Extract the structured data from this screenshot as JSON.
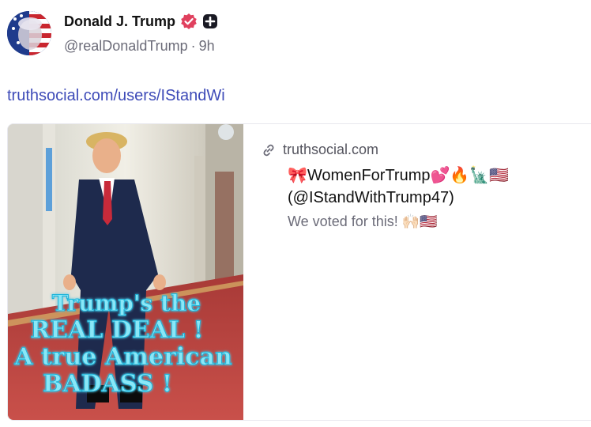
{
  "author": {
    "display_name": "Donald J. Trump",
    "handle": "@realDonaldTrump",
    "separator": "·",
    "time_ago": "9h"
  },
  "post": {
    "link_text": "truthsocial.com/users/IStandWi"
  },
  "link_card": {
    "domain": "truthsocial.com",
    "title_line1": "🎀WomenForTrump💕🔥🗽🇺🇸",
    "title_line2": "(@IStandWithTrump47)",
    "description": "We voted for this! 🙌🏻🇺🇸",
    "image_caption": {
      "line1": "Trump's the",
      "line2": "REAL DEAL !",
      "line3": "A true American",
      "line4": "BADASS !"
    }
  },
  "colors": {
    "link": "#3e4bb8",
    "verified_badge": "#e0405e",
    "muted_text": "#6b6b78",
    "caption_glow": "#39d6f0"
  },
  "icons": {
    "verified": "verified-icon",
    "plus_badge": "truth-plus-icon",
    "link": "link-icon"
  }
}
